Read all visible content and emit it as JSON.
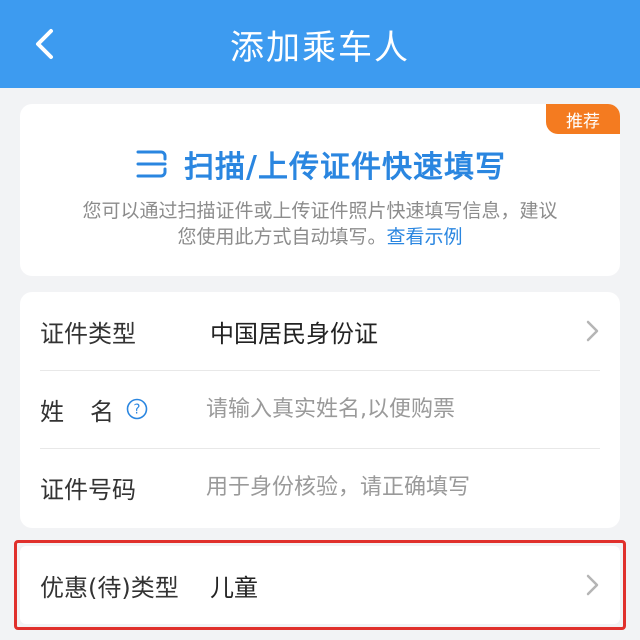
{
  "header": {
    "title": "添加乘车人"
  },
  "scan": {
    "badge": "推荐",
    "title": "扫描/上传证件快速填写",
    "desc_line1": "您可以通过扫描证件或上传证件照片快速填写信息，建议",
    "desc_line2_prefix": "您使用此方式自动填写。",
    "example_link": "查看示例"
  },
  "form": {
    "id_type_label": "证件类型",
    "id_type_value": "中国居民身份证",
    "name_label": "姓名",
    "name_placeholder": "请输入真实姓名,以便购票",
    "id_number_label": "证件号码",
    "id_number_placeholder": "用于身份核验，请正确填写"
  },
  "discount": {
    "label": "优惠(待)类型",
    "value": "儿童"
  },
  "colors": {
    "header_bg": "#3d9bf0",
    "accent": "#2a86e0",
    "badge": "#f47b20",
    "highlight": "#e0302c"
  }
}
